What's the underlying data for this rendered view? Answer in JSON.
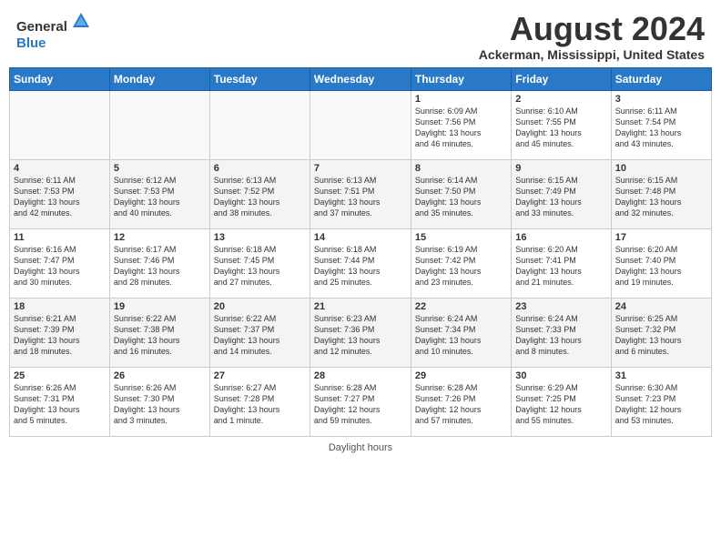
{
  "header": {
    "logo": {
      "general": "General",
      "blue": "Blue"
    },
    "title": "August 2024",
    "subtitle": "Ackerman, Mississippi, United States"
  },
  "calendar": {
    "weekdays": [
      "Sunday",
      "Monday",
      "Tuesday",
      "Wednesday",
      "Thursday",
      "Friday",
      "Saturday"
    ],
    "weeks": [
      [
        {
          "day": "",
          "info": ""
        },
        {
          "day": "",
          "info": ""
        },
        {
          "day": "",
          "info": ""
        },
        {
          "day": "",
          "info": ""
        },
        {
          "day": "1",
          "info": "Sunrise: 6:09 AM\nSunset: 7:56 PM\nDaylight: 13 hours\nand 46 minutes."
        },
        {
          "day": "2",
          "info": "Sunrise: 6:10 AM\nSunset: 7:55 PM\nDaylight: 13 hours\nand 45 minutes."
        },
        {
          "day": "3",
          "info": "Sunrise: 6:11 AM\nSunset: 7:54 PM\nDaylight: 13 hours\nand 43 minutes."
        }
      ],
      [
        {
          "day": "4",
          "info": "Sunrise: 6:11 AM\nSunset: 7:53 PM\nDaylight: 13 hours\nand 42 minutes."
        },
        {
          "day": "5",
          "info": "Sunrise: 6:12 AM\nSunset: 7:53 PM\nDaylight: 13 hours\nand 40 minutes."
        },
        {
          "day": "6",
          "info": "Sunrise: 6:13 AM\nSunset: 7:52 PM\nDaylight: 13 hours\nand 38 minutes."
        },
        {
          "day": "7",
          "info": "Sunrise: 6:13 AM\nSunset: 7:51 PM\nDaylight: 13 hours\nand 37 minutes."
        },
        {
          "day": "8",
          "info": "Sunrise: 6:14 AM\nSunset: 7:50 PM\nDaylight: 13 hours\nand 35 minutes."
        },
        {
          "day": "9",
          "info": "Sunrise: 6:15 AM\nSunset: 7:49 PM\nDaylight: 13 hours\nand 33 minutes."
        },
        {
          "day": "10",
          "info": "Sunrise: 6:15 AM\nSunset: 7:48 PM\nDaylight: 13 hours\nand 32 minutes."
        }
      ],
      [
        {
          "day": "11",
          "info": "Sunrise: 6:16 AM\nSunset: 7:47 PM\nDaylight: 13 hours\nand 30 minutes."
        },
        {
          "day": "12",
          "info": "Sunrise: 6:17 AM\nSunset: 7:46 PM\nDaylight: 13 hours\nand 28 minutes."
        },
        {
          "day": "13",
          "info": "Sunrise: 6:18 AM\nSunset: 7:45 PM\nDaylight: 13 hours\nand 27 minutes."
        },
        {
          "day": "14",
          "info": "Sunrise: 6:18 AM\nSunset: 7:44 PM\nDaylight: 13 hours\nand 25 minutes."
        },
        {
          "day": "15",
          "info": "Sunrise: 6:19 AM\nSunset: 7:42 PM\nDaylight: 13 hours\nand 23 minutes."
        },
        {
          "day": "16",
          "info": "Sunrise: 6:20 AM\nSunset: 7:41 PM\nDaylight: 13 hours\nand 21 minutes."
        },
        {
          "day": "17",
          "info": "Sunrise: 6:20 AM\nSunset: 7:40 PM\nDaylight: 13 hours\nand 19 minutes."
        }
      ],
      [
        {
          "day": "18",
          "info": "Sunrise: 6:21 AM\nSunset: 7:39 PM\nDaylight: 13 hours\nand 18 minutes."
        },
        {
          "day": "19",
          "info": "Sunrise: 6:22 AM\nSunset: 7:38 PM\nDaylight: 13 hours\nand 16 minutes."
        },
        {
          "day": "20",
          "info": "Sunrise: 6:22 AM\nSunset: 7:37 PM\nDaylight: 13 hours\nand 14 minutes."
        },
        {
          "day": "21",
          "info": "Sunrise: 6:23 AM\nSunset: 7:36 PM\nDaylight: 13 hours\nand 12 minutes."
        },
        {
          "day": "22",
          "info": "Sunrise: 6:24 AM\nSunset: 7:34 PM\nDaylight: 13 hours\nand 10 minutes."
        },
        {
          "day": "23",
          "info": "Sunrise: 6:24 AM\nSunset: 7:33 PM\nDaylight: 13 hours\nand 8 minutes."
        },
        {
          "day": "24",
          "info": "Sunrise: 6:25 AM\nSunset: 7:32 PM\nDaylight: 13 hours\nand 6 minutes."
        }
      ],
      [
        {
          "day": "25",
          "info": "Sunrise: 6:26 AM\nSunset: 7:31 PM\nDaylight: 13 hours\nand 5 minutes."
        },
        {
          "day": "26",
          "info": "Sunrise: 6:26 AM\nSunset: 7:30 PM\nDaylight: 13 hours\nand 3 minutes."
        },
        {
          "day": "27",
          "info": "Sunrise: 6:27 AM\nSunset: 7:28 PM\nDaylight: 13 hours\nand 1 minute."
        },
        {
          "day": "28",
          "info": "Sunrise: 6:28 AM\nSunset: 7:27 PM\nDaylight: 12 hours\nand 59 minutes."
        },
        {
          "day": "29",
          "info": "Sunrise: 6:28 AM\nSunset: 7:26 PM\nDaylight: 12 hours\nand 57 minutes."
        },
        {
          "day": "30",
          "info": "Sunrise: 6:29 AM\nSunset: 7:25 PM\nDaylight: 12 hours\nand 55 minutes."
        },
        {
          "day": "31",
          "info": "Sunrise: 6:30 AM\nSunset: 7:23 PM\nDaylight: 12 hours\nand 53 minutes."
        }
      ]
    ]
  },
  "footer": {
    "text": "Daylight hours"
  }
}
